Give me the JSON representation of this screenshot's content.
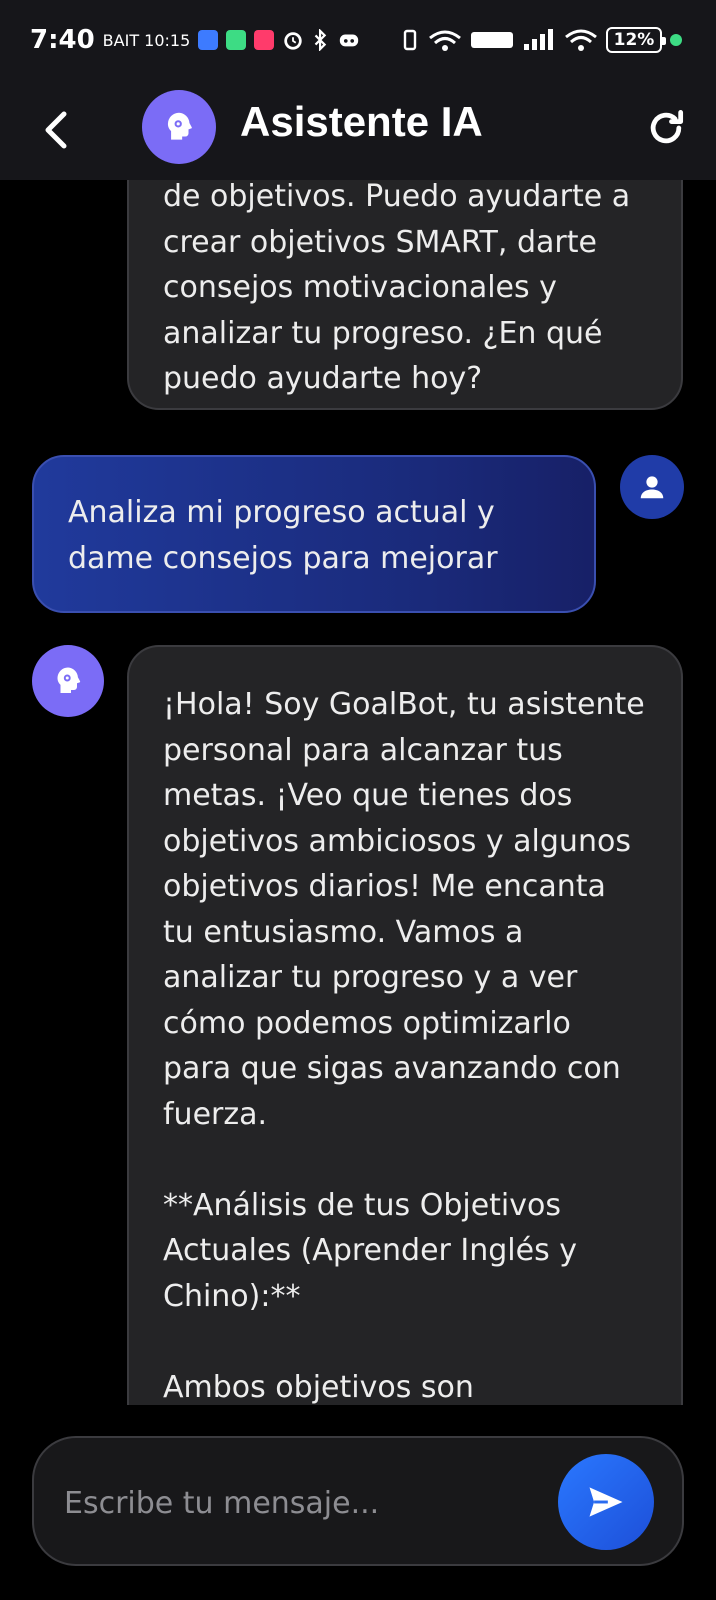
{
  "status_bar": {
    "time": "7:40",
    "carrier_overlay": "BAIT 10:15",
    "battery": "12%"
  },
  "header": {
    "title": "Asistente IA"
  },
  "messages": [
    {
      "role": "assistant",
      "text": "de objetivos. Puedo ayudarte a\ncrear objetivos SMART, darte\nconsejos motivacionales y\nanalizar tu progreso. ¿En qué\npuedo ayudarte hoy?"
    },
    {
      "role": "user",
      "text": "Analiza mi progreso actual y\ndame consejos para mejorar"
    },
    {
      "role": "assistant",
      "text": "¡Hola! Soy GoalBot, tu asistente\npersonal para alcanzar tus\nmetas. ¡Veo que tienes dos\nobjetivos ambiciosos y algunos\nobjetivos diarios! Me encanta\ntu entusiasmo. Vamos a\nanalizar tu progreso y a ver\ncómo podemos optimizarlo\npara que sigas avanzando con\nfuerza.\n\n**Análisis de tus Objetivos\nActuales (Aprender Inglés y\nChino):**\n\nAmbos objetivos son"
    }
  ],
  "input": {
    "placeholder": "Escribe tu mensaje..."
  },
  "icons": {
    "back": "chevron-left-icon",
    "assistant_avatar": "brain-head-icon",
    "user_avatar": "person-icon",
    "refresh": "refresh-icon",
    "send": "send-icon"
  },
  "colors": {
    "background": "#000000",
    "header": "#16161a",
    "assistant_bubble": "#242426",
    "user_bubble": "#1f3497",
    "accent_purple": "#7b6cf6",
    "send_button": "#2a6cf0"
  }
}
